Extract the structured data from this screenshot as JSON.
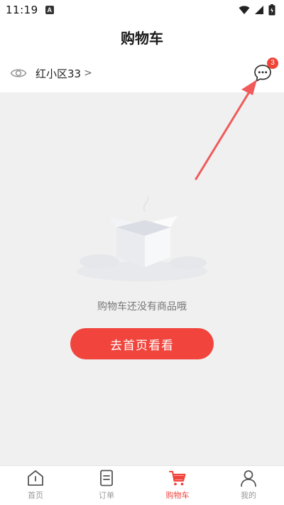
{
  "status_bar": {
    "time": "11:19",
    "notification_letter": "A"
  },
  "header": {
    "title": "购物车"
  },
  "store": {
    "name": "红小区33",
    "chevron": ">"
  },
  "messages": {
    "badge_count": "3"
  },
  "empty_state": {
    "message": "购物车还没有商品哦",
    "button_label": "去首页看看"
  },
  "bottom_nav": {
    "items": [
      {
        "label": "首页",
        "icon": "home-icon",
        "active": false
      },
      {
        "label": "订单",
        "icon": "order-icon",
        "active": false
      },
      {
        "label": "购物车",
        "icon": "cart-icon",
        "active": true
      },
      {
        "label": "我的",
        "icon": "profile-icon",
        "active": false
      }
    ]
  },
  "colors": {
    "accent": "#f0443c",
    "arrow": "#f05a5a",
    "background": "#f0f0f0"
  }
}
